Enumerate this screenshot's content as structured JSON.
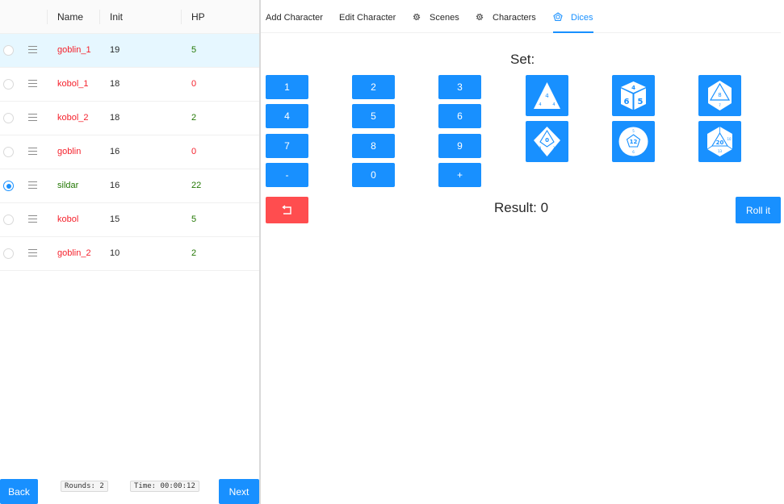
{
  "table": {
    "columns": {
      "name": "Name",
      "init": "Init",
      "hp": "HP"
    },
    "rows": [
      {
        "name": "goblin_1",
        "init": "19",
        "hp": "5",
        "name_color": "red",
        "hp_color": "green",
        "selected": true,
        "checked": false
      },
      {
        "name": "kobol_1",
        "init": "18",
        "hp": "0",
        "name_color": "red",
        "hp_color": "red",
        "selected": false,
        "checked": false
      },
      {
        "name": "kobol_2",
        "init": "18",
        "hp": "2",
        "name_color": "red",
        "hp_color": "green",
        "selected": false,
        "checked": false
      },
      {
        "name": "goblin",
        "init": "16",
        "hp": "0",
        "name_color": "red",
        "hp_color": "red",
        "selected": false,
        "checked": false
      },
      {
        "name": "sildar",
        "init": "16",
        "hp": "22",
        "name_color": "green",
        "hp_color": "green",
        "selected": false,
        "checked": true
      },
      {
        "name": "kobol",
        "init": "15",
        "hp": "5",
        "name_color": "red",
        "hp_color": "green",
        "selected": false,
        "checked": false
      },
      {
        "name": "goblin_2",
        "init": "10",
        "hp": "2",
        "name_color": "red",
        "hp_color": "green",
        "selected": false,
        "checked": false
      }
    ]
  },
  "footer": {
    "back_label": "Back",
    "rounds": "Rounds: 2",
    "time": "Time: 00:00:12",
    "next_label": "Next"
  },
  "tabs": [
    {
      "label": "Add Character",
      "icon": "",
      "active": false
    },
    {
      "label": "Edit Character",
      "icon": "",
      "active": false
    },
    {
      "label": "Scenes",
      "icon": "gear-icon",
      "active": false
    },
    {
      "label": "Characters",
      "icon": "gear-icon",
      "active": false
    },
    {
      "label": "Dices",
      "icon": "pentagon-die-icon",
      "active": true
    }
  ],
  "dice_panel": {
    "set_label": "Set:",
    "keys": [
      "1",
      "2",
      "3",
      "4",
      "5",
      "6",
      "7",
      "8",
      "9",
      "-",
      "0",
      "+"
    ],
    "dice": [
      {
        "icon": "d4-icon",
        "label": "4"
      },
      {
        "icon": "d6-icon",
        "label": "6"
      },
      {
        "icon": "d8-icon",
        "label": "8"
      },
      {
        "icon": "d10-icon",
        "label": "0"
      },
      {
        "icon": "d12-icon",
        "label": "12"
      },
      {
        "icon": "d20-icon",
        "label": "20"
      }
    ],
    "result_label": "Result: 0",
    "roll_label": "Roll it",
    "undo_icon": "undo-icon"
  },
  "colors": {
    "primary": "#1890ff",
    "danger": "#ff4d4f",
    "selected_row": "#e6f7ff",
    "hp_red": "#f5222d",
    "hp_green": "#237804"
  }
}
